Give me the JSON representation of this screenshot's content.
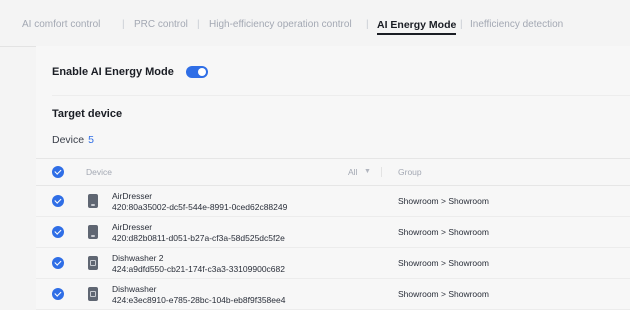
{
  "tabs": [
    {
      "label": "AI comfort control",
      "active": false
    },
    {
      "label": "PRC control",
      "active": false
    },
    {
      "label": "High-efficiency operation control",
      "active": false
    },
    {
      "label": "AI Energy Mode",
      "active": true
    },
    {
      "label": "Inefficiency detection",
      "active": false
    }
  ],
  "settings": {
    "enable_label": "Enable AI Energy Mode",
    "enabled": true
  },
  "target": {
    "title": "Target device",
    "device_label": "Device",
    "device_count": "5"
  },
  "table": {
    "columns": {
      "device": "Device",
      "filter": "All",
      "group": "Group"
    },
    "rows": [
      {
        "icon": "dresser-icon",
        "name": "AirDresser",
        "id": "420:80a35002-dc5f-544e-8991-0ced62c88249",
        "group": "Showroom > Showroom"
      },
      {
        "icon": "dresser-icon",
        "name": "AirDresser",
        "id": "420:d82b0811-d051-b27a-cf3a-58d525dc5f2e",
        "group": "Showroom > Showroom"
      },
      {
        "icon": "dishwasher-icon",
        "name": "Dishwasher 2",
        "id": "424:a9dfd550-cb21-174f-c3a3-33109900c682",
        "group": "Showroom > Showroom"
      },
      {
        "icon": "dishwasher-icon",
        "name": "Dishwasher",
        "id": "424:e3ec8910-e785-28bc-104b-eb8f9f358ee4",
        "group": "Showroom > Showroom"
      }
    ]
  },
  "colors": {
    "accent": "#2f6ee6",
    "text": "#1a1d24",
    "muted": "#a3a8b3"
  }
}
